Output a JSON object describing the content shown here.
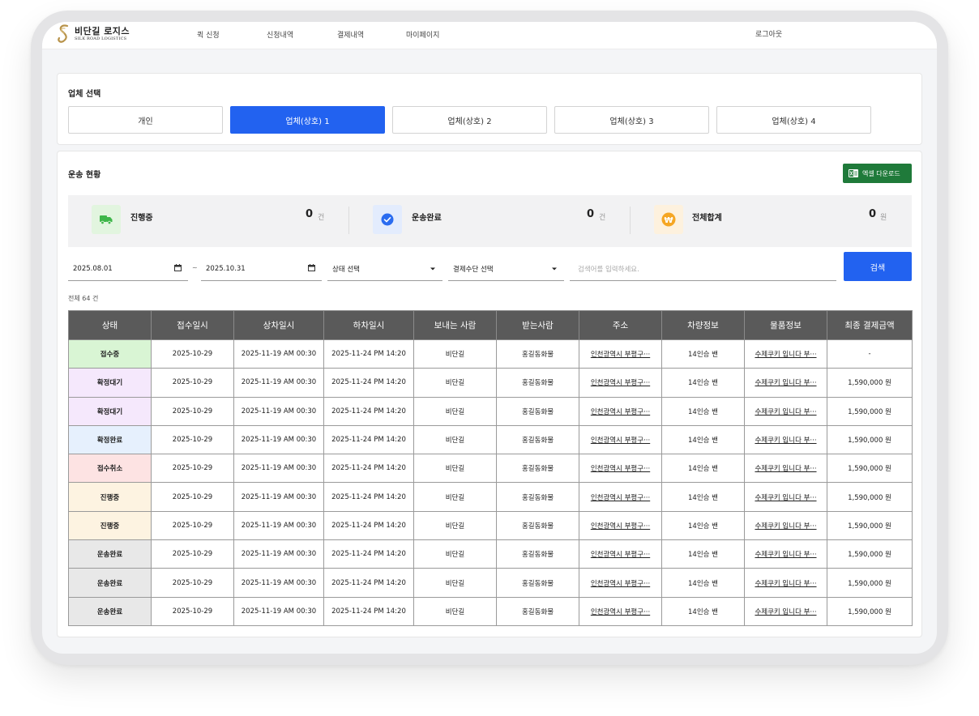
{
  "brand": {
    "name_ko": "비단길 로지스",
    "name_en": "SILK ROAD LOGISTICS"
  },
  "nav": {
    "items": [
      "퀵 신청",
      "신청내역",
      "결제내역",
      "마이페이지"
    ],
    "logout": "로그아웃"
  },
  "company_select": {
    "title": "업체 선택",
    "options": [
      "개인",
      "업체(상호) 1",
      "업체(상호) 2",
      "업체(상호) 3",
      "업체(상호) 4"
    ],
    "selected_index": 1
  },
  "transport": {
    "title": "운송 현황",
    "excel_button": "엑셀 다운로드",
    "stats": [
      {
        "label": "진행중",
        "value": "0",
        "unit": "건",
        "icon": "truck-icon"
      },
      {
        "label": "운송완료",
        "value": "0",
        "unit": "건",
        "icon": "check-circle-icon"
      },
      {
        "label": "전체합계",
        "value": "0",
        "unit": "원",
        "icon": "won-coin-icon"
      }
    ]
  },
  "filters": {
    "date_from": "2025.08.01",
    "date_to": "2025.10.31",
    "separator": "~",
    "status_select": "상태 선택",
    "payment_select": "결제수단 선택",
    "search_placeholder": "검색어를 입력하세요.",
    "search_button": "검색",
    "total_count": "전체 64 건"
  },
  "table": {
    "columns": [
      "상태",
      "접수일시",
      "상차일시",
      "하차일시",
      "보내는 사람",
      "받는사람",
      "주소",
      "차량정보",
      "물품정보",
      "최종 결제금액"
    ],
    "rows": [
      {
        "status": "접수중",
        "status_color": "#d9f5d4",
        "received": "2025-10-29",
        "pickup": "2025-11-19 AM 00:30",
        "dropoff": "2025-11-24 PM 14:20",
        "sender": "비단길",
        "receiver": "홍길동화물",
        "address": "인천광역시 부평구···",
        "vehicle": "14인승 밴",
        "goods": "수제쿠키 입니다 부···",
        "amount": "-"
      },
      {
        "status": "확정대기",
        "status_color": "#f5e8fc",
        "received": "2025-10-29",
        "pickup": "2025-11-19 AM 00:30",
        "dropoff": "2025-11-24 PM 14:20",
        "sender": "비단길",
        "receiver": "홍길동화물",
        "address": "인천광역시 부평구···",
        "vehicle": "14인승 밴",
        "goods": "수제쿠키 입니다 부···",
        "amount": "1,590,000 원"
      },
      {
        "status": "확정대기",
        "status_color": "#f5e8fc",
        "received": "2025-10-29",
        "pickup": "2025-11-19 AM 00:30",
        "dropoff": "2025-11-24 PM 14:20",
        "sender": "비단길",
        "receiver": "홍길동화물",
        "address": "인천광역시 부평구···",
        "vehicle": "14인승 밴",
        "goods": "수제쿠키 입니다 부···",
        "amount": "1,590,000 원"
      },
      {
        "status": "확정완료",
        "status_color": "#e6f0fd",
        "received": "2025-10-29",
        "pickup": "2025-11-19 AM 00:30",
        "dropoff": "2025-11-24 PM 14:20",
        "sender": "비단길",
        "receiver": "홍길동화물",
        "address": "인천광역시 부평구···",
        "vehicle": "14인승 밴",
        "goods": "수제쿠키 입니다 부···",
        "amount": "1,590,000 원"
      },
      {
        "status": "접수취소",
        "status_color": "#fde3e3",
        "received": "2025-10-29",
        "pickup": "2025-11-19 AM 00:30",
        "dropoff": "2025-11-24 PM 14:20",
        "sender": "비단길",
        "receiver": "홍길동화물",
        "address": "인천광역시 부평구···",
        "vehicle": "14인승 밴",
        "goods": "수제쿠키 입니다 부···",
        "amount": "1,590,000 원"
      },
      {
        "status": "진행중",
        "status_color": "#fdf3e1",
        "received": "2025-10-29",
        "pickup": "2025-11-19 AM 00:30",
        "dropoff": "2025-11-24 PM 14:20",
        "sender": "비단길",
        "receiver": "홍길동화물",
        "address": "인천광역시 부평구···",
        "vehicle": "14인승 밴",
        "goods": "수제쿠키 입니다 부···",
        "amount": "1,590,000 원"
      },
      {
        "status": "진행중",
        "status_color": "#fdf3e1",
        "received": "2025-10-29",
        "pickup": "2025-11-19 AM 00:30",
        "dropoff": "2025-11-24 PM 14:20",
        "sender": "비단길",
        "receiver": "홍길동화물",
        "address": "인천광역시 부평구···",
        "vehicle": "14인승 밴",
        "goods": "수제쿠키 입니다 부···",
        "amount": "1,590,000 원"
      },
      {
        "status": "운송완료",
        "status_color": "#e8e8e8",
        "received": "2025-10-29",
        "pickup": "2025-11-19 AM 00:30",
        "dropoff": "2025-11-24 PM 14:20",
        "sender": "비단길",
        "receiver": "홍길동화물",
        "address": "인천광역시 부평구···",
        "vehicle": "14인승 밴",
        "goods": "수제쿠키 입니다 부···",
        "amount": "1,590,000 원"
      },
      {
        "status": "운송완료",
        "status_color": "#e8e8e8",
        "received": "2025-10-29",
        "pickup": "2025-11-19 AM 00:30",
        "dropoff": "2025-11-24 PM 14:20",
        "sender": "비단길",
        "receiver": "홍길동화물",
        "address": "인천광역시 부평구···",
        "vehicle": "14인승 밴",
        "goods": "수제쿠키 입니다 부···",
        "amount": "1,590,000 원"
      },
      {
        "status": "운송완료",
        "status_color": "#e8e8e8",
        "received": "2025-10-29",
        "pickup": "2025-11-19 AM 00:30",
        "dropoff": "2025-11-24 PM 14:20",
        "sender": "비단길",
        "receiver": "홍길동화물",
        "address": "인천광역시 부평구···",
        "vehicle": "14인승 밴",
        "goods": "수제쿠키 입니다 부···",
        "amount": "1,590,000 원"
      }
    ]
  },
  "colors": {
    "accent": "#2262f0",
    "excel_green": "#1f7a3a",
    "table_header": "#5a5a5a",
    "logo_gold": "#b8934a"
  }
}
